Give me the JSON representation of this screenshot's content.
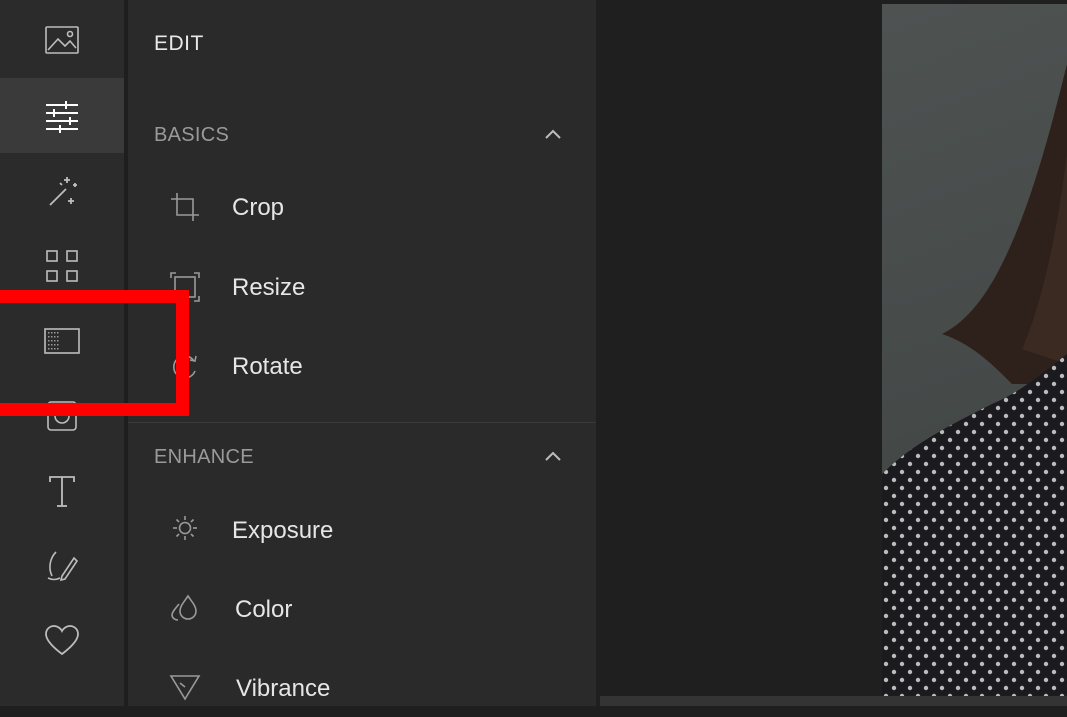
{
  "rail": {
    "items": [
      {
        "icon": "image-icon"
      },
      {
        "icon": "sliders-icon",
        "active": true
      },
      {
        "icon": "magic-wand-icon"
      },
      {
        "icon": "grid-icon"
      },
      {
        "icon": "texture-icon"
      },
      {
        "icon": "frame-icon"
      },
      {
        "icon": "text-icon"
      },
      {
        "icon": "draw-icon"
      },
      {
        "icon": "heart-icon"
      }
    ]
  },
  "panel": {
    "title": "EDIT",
    "sections": [
      {
        "label": "BASICS",
        "items": [
          {
            "label": "Crop",
            "icon": "crop-icon"
          },
          {
            "label": "Resize",
            "icon": "resize-icon"
          },
          {
            "label": "Rotate",
            "icon": "rotate-icon"
          }
        ]
      },
      {
        "label": "ENHANCE",
        "items": [
          {
            "label": "Exposure",
            "icon": "sun-icon"
          },
          {
            "label": "Color",
            "icon": "drops-icon"
          },
          {
            "label": "Vibrance",
            "icon": "triangle-icon"
          }
        ]
      }
    ]
  },
  "colors": {
    "rail_bg": "#2b2b2b",
    "panel_bg": "#2a2a2a",
    "canvas_bg": "#1f1f1f",
    "active_bg": "#3a3a3a",
    "highlight": "#ff0000",
    "text_primary": "#e6e6e6",
    "text_secondary": "#9a9a9a"
  }
}
